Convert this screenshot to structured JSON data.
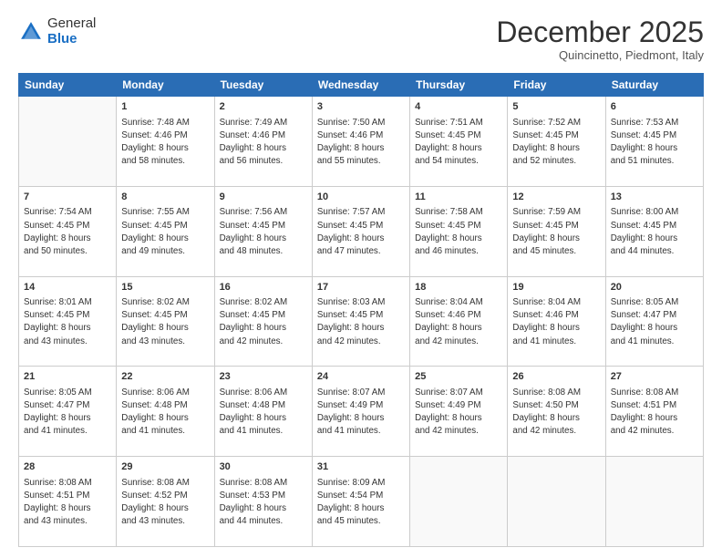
{
  "logo": {
    "general": "General",
    "blue": "Blue"
  },
  "header": {
    "month": "December 2025",
    "location": "Quincinetto, Piedmont, Italy"
  },
  "days_of_week": [
    "Sunday",
    "Monday",
    "Tuesday",
    "Wednesday",
    "Thursday",
    "Friday",
    "Saturday"
  ],
  "weeks": [
    [
      {
        "day": "",
        "info": ""
      },
      {
        "day": "1",
        "info": "Sunrise: 7:48 AM\nSunset: 4:46 PM\nDaylight: 8 hours\nand 58 minutes."
      },
      {
        "day": "2",
        "info": "Sunrise: 7:49 AM\nSunset: 4:46 PM\nDaylight: 8 hours\nand 56 minutes."
      },
      {
        "day": "3",
        "info": "Sunrise: 7:50 AM\nSunset: 4:46 PM\nDaylight: 8 hours\nand 55 minutes."
      },
      {
        "day": "4",
        "info": "Sunrise: 7:51 AM\nSunset: 4:45 PM\nDaylight: 8 hours\nand 54 minutes."
      },
      {
        "day": "5",
        "info": "Sunrise: 7:52 AM\nSunset: 4:45 PM\nDaylight: 8 hours\nand 52 minutes."
      },
      {
        "day": "6",
        "info": "Sunrise: 7:53 AM\nSunset: 4:45 PM\nDaylight: 8 hours\nand 51 minutes."
      }
    ],
    [
      {
        "day": "7",
        "info": "Sunrise: 7:54 AM\nSunset: 4:45 PM\nDaylight: 8 hours\nand 50 minutes."
      },
      {
        "day": "8",
        "info": "Sunrise: 7:55 AM\nSunset: 4:45 PM\nDaylight: 8 hours\nand 49 minutes."
      },
      {
        "day": "9",
        "info": "Sunrise: 7:56 AM\nSunset: 4:45 PM\nDaylight: 8 hours\nand 48 minutes."
      },
      {
        "day": "10",
        "info": "Sunrise: 7:57 AM\nSunset: 4:45 PM\nDaylight: 8 hours\nand 47 minutes."
      },
      {
        "day": "11",
        "info": "Sunrise: 7:58 AM\nSunset: 4:45 PM\nDaylight: 8 hours\nand 46 minutes."
      },
      {
        "day": "12",
        "info": "Sunrise: 7:59 AM\nSunset: 4:45 PM\nDaylight: 8 hours\nand 45 minutes."
      },
      {
        "day": "13",
        "info": "Sunrise: 8:00 AM\nSunset: 4:45 PM\nDaylight: 8 hours\nand 44 minutes."
      }
    ],
    [
      {
        "day": "14",
        "info": "Sunrise: 8:01 AM\nSunset: 4:45 PM\nDaylight: 8 hours\nand 43 minutes."
      },
      {
        "day": "15",
        "info": "Sunrise: 8:02 AM\nSunset: 4:45 PM\nDaylight: 8 hours\nand 43 minutes."
      },
      {
        "day": "16",
        "info": "Sunrise: 8:02 AM\nSunset: 4:45 PM\nDaylight: 8 hours\nand 42 minutes."
      },
      {
        "day": "17",
        "info": "Sunrise: 8:03 AM\nSunset: 4:45 PM\nDaylight: 8 hours\nand 42 minutes."
      },
      {
        "day": "18",
        "info": "Sunrise: 8:04 AM\nSunset: 4:46 PM\nDaylight: 8 hours\nand 42 minutes."
      },
      {
        "day": "19",
        "info": "Sunrise: 8:04 AM\nSunset: 4:46 PM\nDaylight: 8 hours\nand 41 minutes."
      },
      {
        "day": "20",
        "info": "Sunrise: 8:05 AM\nSunset: 4:47 PM\nDaylight: 8 hours\nand 41 minutes."
      }
    ],
    [
      {
        "day": "21",
        "info": "Sunrise: 8:05 AM\nSunset: 4:47 PM\nDaylight: 8 hours\nand 41 minutes."
      },
      {
        "day": "22",
        "info": "Sunrise: 8:06 AM\nSunset: 4:48 PM\nDaylight: 8 hours\nand 41 minutes."
      },
      {
        "day": "23",
        "info": "Sunrise: 8:06 AM\nSunset: 4:48 PM\nDaylight: 8 hours\nand 41 minutes."
      },
      {
        "day": "24",
        "info": "Sunrise: 8:07 AM\nSunset: 4:49 PM\nDaylight: 8 hours\nand 41 minutes."
      },
      {
        "day": "25",
        "info": "Sunrise: 8:07 AM\nSunset: 4:49 PM\nDaylight: 8 hours\nand 42 minutes."
      },
      {
        "day": "26",
        "info": "Sunrise: 8:08 AM\nSunset: 4:50 PM\nDaylight: 8 hours\nand 42 minutes."
      },
      {
        "day": "27",
        "info": "Sunrise: 8:08 AM\nSunset: 4:51 PM\nDaylight: 8 hours\nand 42 minutes."
      }
    ],
    [
      {
        "day": "28",
        "info": "Sunrise: 8:08 AM\nSunset: 4:51 PM\nDaylight: 8 hours\nand 43 minutes."
      },
      {
        "day": "29",
        "info": "Sunrise: 8:08 AM\nSunset: 4:52 PM\nDaylight: 8 hours\nand 43 minutes."
      },
      {
        "day": "30",
        "info": "Sunrise: 8:08 AM\nSunset: 4:53 PM\nDaylight: 8 hours\nand 44 minutes."
      },
      {
        "day": "31",
        "info": "Sunrise: 8:09 AM\nSunset: 4:54 PM\nDaylight: 8 hours\nand 45 minutes."
      },
      {
        "day": "",
        "info": ""
      },
      {
        "day": "",
        "info": ""
      },
      {
        "day": "",
        "info": ""
      }
    ]
  ]
}
